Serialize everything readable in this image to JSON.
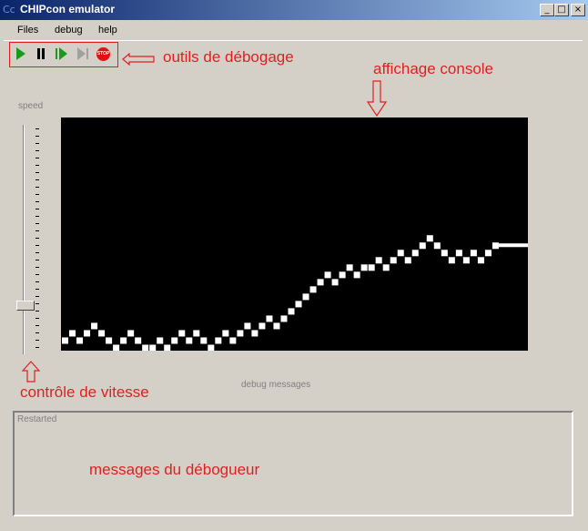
{
  "window": {
    "title": "CHIPcon emulator",
    "icon_text": "Cc",
    "controls": {
      "minimize": "_",
      "maximize": "□",
      "close": "×"
    }
  },
  "menu": [
    "Files",
    "debug",
    "help"
  ],
  "toolbar": {
    "tools": [
      "play-icon",
      "pause-icon",
      "step-icon",
      "step-end-icon",
      "stop-icon"
    ],
    "stop_text": "STOP"
  },
  "annotations": {
    "tools": "outils de débogage",
    "console": "affichage console",
    "speed": "contrôle de vitesse",
    "messages": "messages du débogueur"
  },
  "speed": {
    "label": "speed",
    "level": 0.2
  },
  "console": {
    "background": "#000000",
    "pixel_color": "#ffffff",
    "resolution": [
      64,
      32
    ]
  },
  "debug": {
    "label": "debug messages",
    "text": "Restarted"
  },
  "colors": {
    "annotation": "#e02020",
    "play": "#1a9a1a",
    "stop": "#e21010"
  }
}
